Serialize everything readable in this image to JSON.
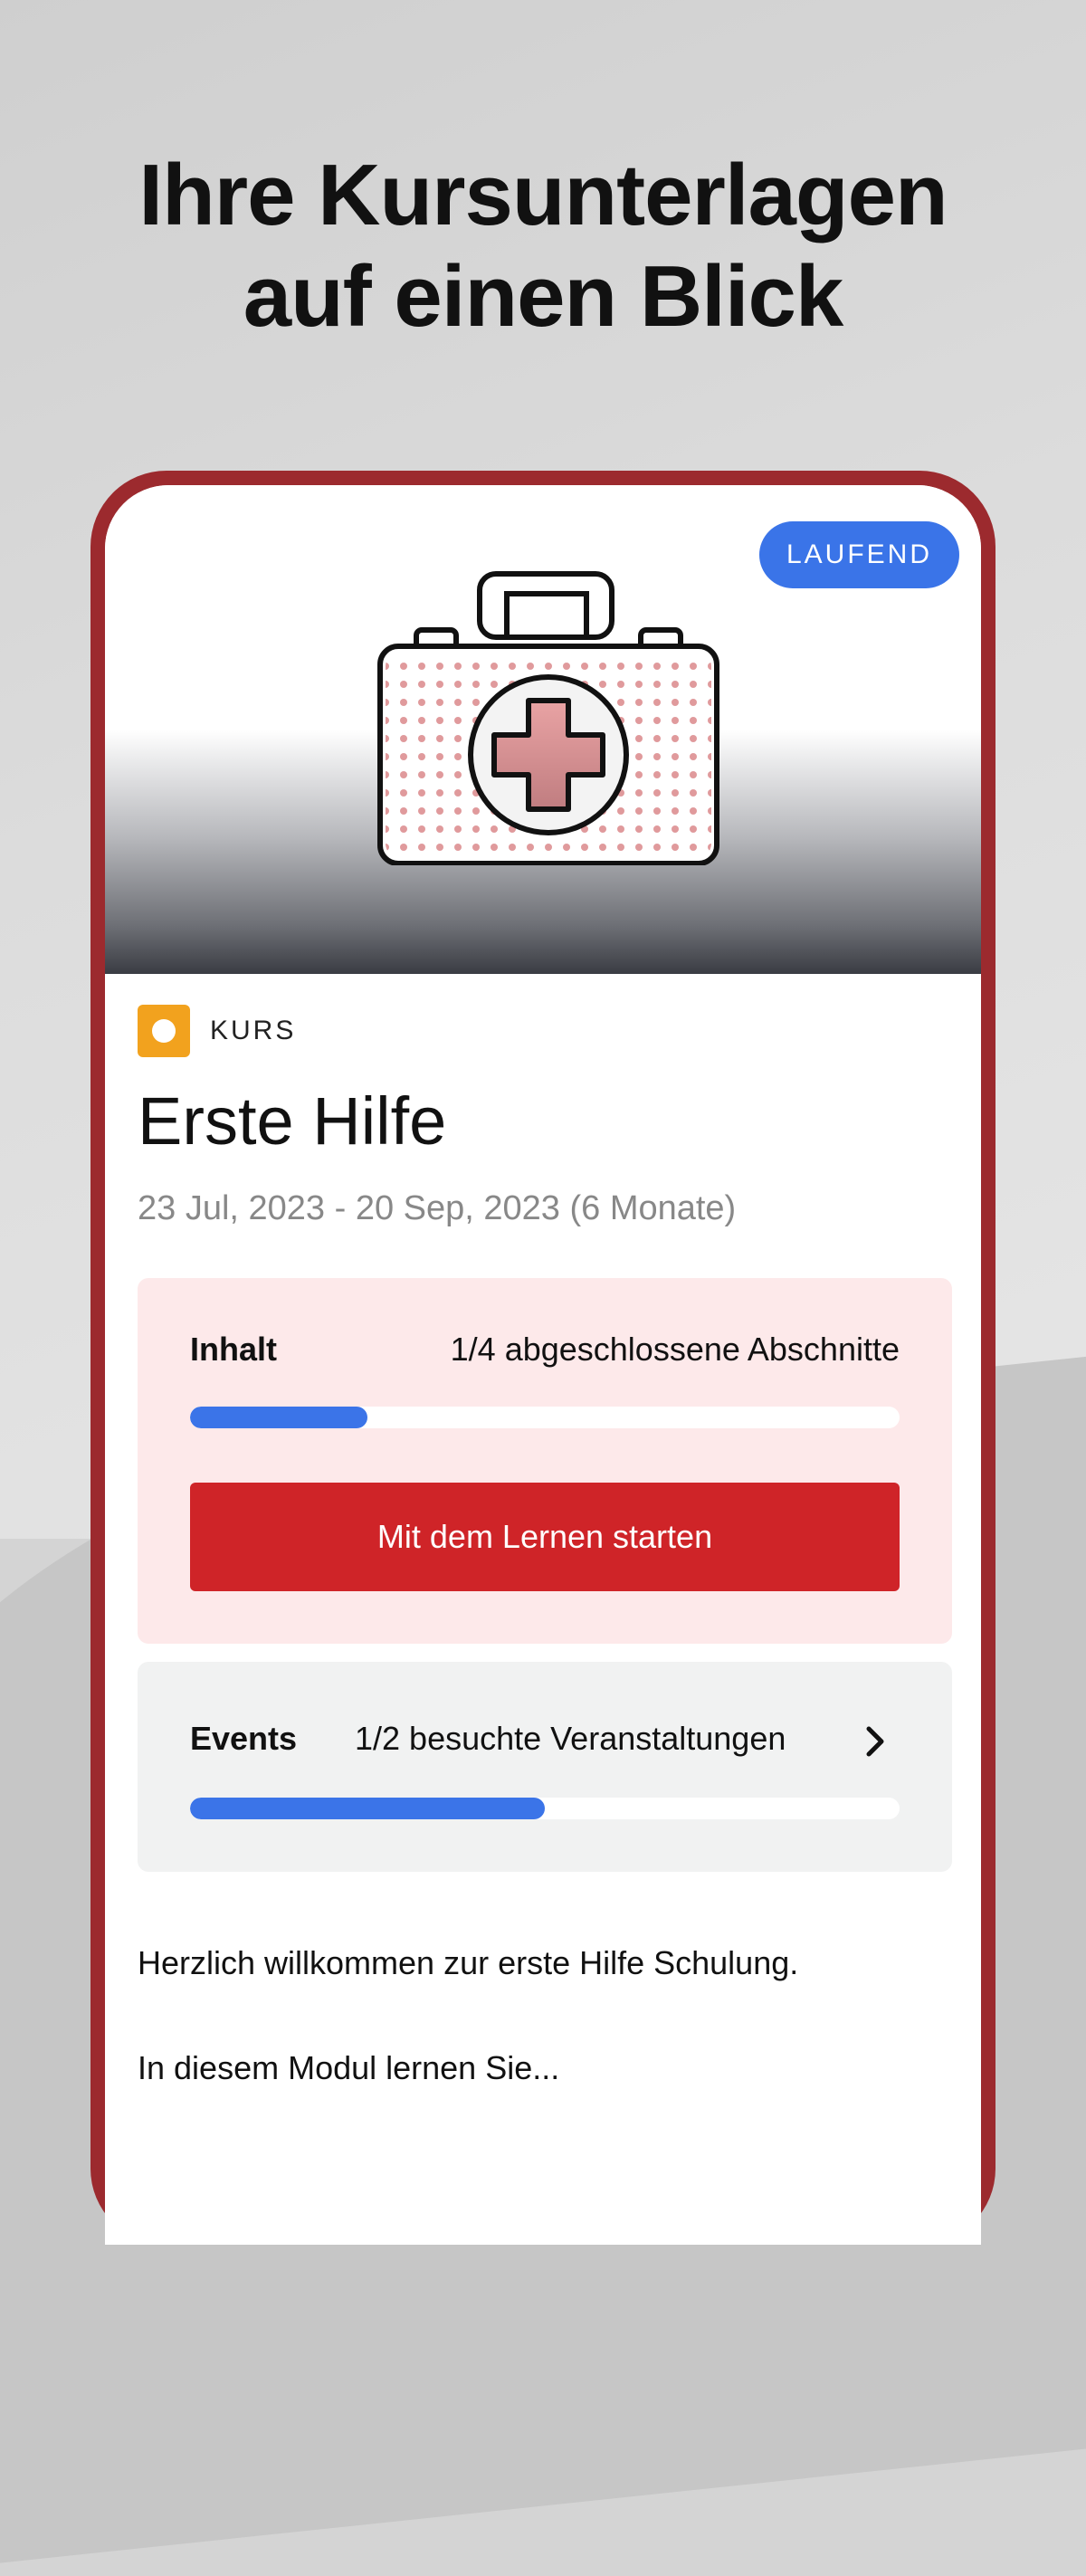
{
  "headline": {
    "line1": "Ihre Kursunterlagen",
    "line2": "auf einen Blick"
  },
  "course": {
    "status_badge": "LAUFEND",
    "type_label": "KURS",
    "type_color": "#f2a21e",
    "title": "Erste Hilfe",
    "dates": "23 Jul, 2023 - 20 Sep, 2023 (6 Monate)",
    "hero_icon": "first-aid-kit-icon"
  },
  "content_card": {
    "label": "Inhalt",
    "value": "1/4 abgeschlossene Abschnitte",
    "progress": 0.25,
    "button_label": "Mit dem Lernen starten"
  },
  "events_card": {
    "label": "Events",
    "value": "1/2 besuchte Veranstaltungen",
    "progress": 0.5,
    "icon": "chevron-right-icon"
  },
  "description": {
    "line1": "Herzlich willkommen zur erste Hilfe Schulung.",
    "line2": "In diesem Modul lernen Sie..."
  },
  "colors": {
    "accent_blue": "#3b74e8",
    "primary_red": "#cf2428",
    "frame_red": "#9c2a2e"
  }
}
